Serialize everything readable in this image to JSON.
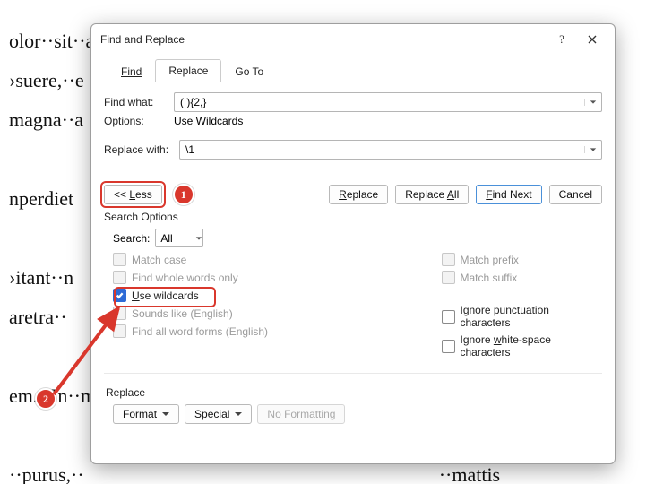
{
  "doc_text": "olor··sit··a                                                                          ecenas··\n›suere,··e                                                                            s··male\nmagna··a\n\nnperdiet\n\n›itant··n                                                                             esuada·\naretra··\n\nem.··In··m                                                                              ¶\n\n··purus,··                                                                        ··mattis\nsem··ver                                                                         sem··m",
  "dialog": {
    "title": "Find and Replace",
    "help_label": "?",
    "tabs": {
      "find": "Find",
      "replace": "Replace",
      "goto": "Go To"
    },
    "find_what_label": "Find what:",
    "find_what_value": "( ){2,}",
    "options_label": "Options:",
    "options_value": "Use Wildcards",
    "replace_with_label": "Replace with:",
    "replace_with_value": "\\1",
    "buttons": {
      "less": "<< Less",
      "replace": "Replace",
      "replace_all": "Replace All",
      "find_next": "Find Next",
      "cancel": "Cancel"
    },
    "search_options_label": "Search Options",
    "search_label": "Search:",
    "search_value": "All",
    "left_checks": {
      "match_case": "Match case",
      "whole_words": "Find whole words only",
      "wildcards": "Use wildcards",
      "sounds_like": "Sounds like (English)",
      "word_forms": "Find all word forms (English)"
    },
    "right_checks": {
      "prefix": "Match prefix",
      "suffix": "Match suffix",
      "punct": "Ignore punctuation characters",
      "whitespace": "Ignore white-space characters"
    },
    "replace_section_label": "Replace",
    "format_btn": "Format",
    "special_btn": "Special",
    "no_formatting_btn": "No Formatting"
  },
  "annotations": {
    "marker1": "1",
    "marker2": "2"
  }
}
